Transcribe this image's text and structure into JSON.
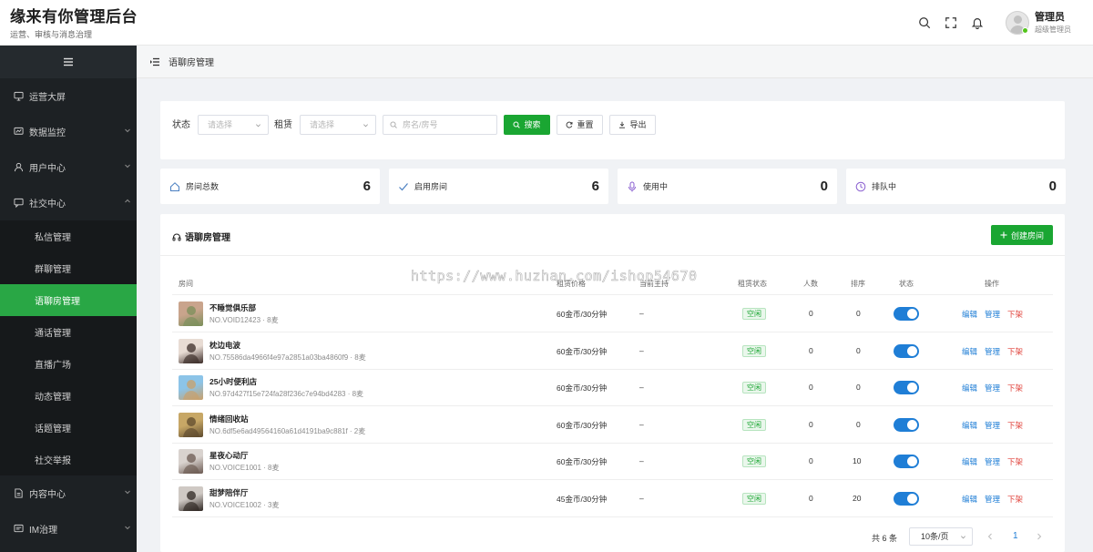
{
  "header": {
    "title": "缘来有你管理后台",
    "subtitle": "运营、审核与消息治理",
    "user_name": "管理员",
    "user_role": "超级管理员"
  },
  "sidebar": {
    "items": [
      {
        "label": "运营大屏",
        "icon": "monitor-icon"
      },
      {
        "label": "数据监控",
        "icon": "chart-icon"
      },
      {
        "label": "用户中心",
        "icon": "user-icon"
      },
      {
        "label": "社交中心",
        "icon": "chat-icon"
      },
      {
        "label": "内容中心",
        "icon": "document-icon"
      },
      {
        "label": "IM治理",
        "icon": "message-icon"
      }
    ],
    "sub_items": [
      "私信管理",
      "群聊管理",
      "语聊房管理",
      "通话管理",
      "直播广场",
      "动态管理",
      "话题管理",
      "社交举报"
    ],
    "active_sub": "语聊房管理"
  },
  "breadcrumb": "语聊房管理",
  "filters": {
    "status_label": "状态",
    "status_placeholder": "请选择",
    "rent_label": "租赁",
    "rent_placeholder": "请选择",
    "search_placeholder": "房名/房号",
    "search_btn": "搜索",
    "reset_btn": "重置",
    "export_btn": "导出"
  },
  "stats": [
    {
      "label": "房间总数",
      "value": "6"
    },
    {
      "label": "启用房间",
      "value": "6"
    },
    {
      "label": "使用中",
      "value": "0"
    },
    {
      "label": "排队中",
      "value": "0"
    }
  ],
  "table": {
    "title": "语聊房管理",
    "create_btn": "创建房间",
    "columns": [
      "房间",
      "租赁价格",
      "当前主持",
      "租赁状态",
      "人数",
      "排序",
      "状态",
      "操作"
    ],
    "rows": [
      {
        "name": "不睡觉俱乐部",
        "no": "NO.VOID12423 · 8麦",
        "price": "60金币/30分钟",
        "host": "–",
        "rent_status": "空闲",
        "people": "0",
        "sort": "0",
        "enabled": true
      },
      {
        "name": "枕边电波",
        "no": "NO.75586da4966f4e97a2851a03ba4860f9 · 8麦",
        "price": "60金币/30分钟",
        "host": "–",
        "rent_status": "空闲",
        "people": "0",
        "sort": "0",
        "enabled": true
      },
      {
        "name": "25小时便利店",
        "no": "NO.97d427f15e724fa28f236c7e94bd4283 · 8麦",
        "price": "60金币/30分钟",
        "host": "–",
        "rent_status": "空闲",
        "people": "0",
        "sort": "0",
        "enabled": true
      },
      {
        "name": "情绪回收站",
        "no": "NO.6df5e6ad49564160a61d4191ba9c881f · 2麦",
        "price": "60金币/30分钟",
        "host": "–",
        "rent_status": "空闲",
        "people": "0",
        "sort": "0",
        "enabled": true
      },
      {
        "name": "星夜心动厅",
        "no": "NO.VOICE1001 · 8麦",
        "price": "60金币/30分钟",
        "host": "–",
        "rent_status": "空闲",
        "people": "0",
        "sort": "10",
        "enabled": true
      },
      {
        "name": "甜梦陪伴厅",
        "no": "NO.VOICE1002 · 3麦",
        "price": "45金币/30分钟",
        "host": "–",
        "rent_status": "空闲",
        "people": "0",
        "sort": "20",
        "enabled": true
      }
    ],
    "actions": {
      "edit": "编辑",
      "manage": "管理",
      "offline": "下架"
    }
  },
  "pagination": {
    "total": "共 6 条",
    "page_size": "10条/页",
    "current_page": "1"
  },
  "watermark": "https://www.huzhan.com/ishop54670",
  "colors": {
    "primary": "#1aa632",
    "link": "#1f7ed6",
    "danger": "#e0413a",
    "sidebar_bg": "#1d2124",
    "sidebar_active": "#29a745"
  }
}
